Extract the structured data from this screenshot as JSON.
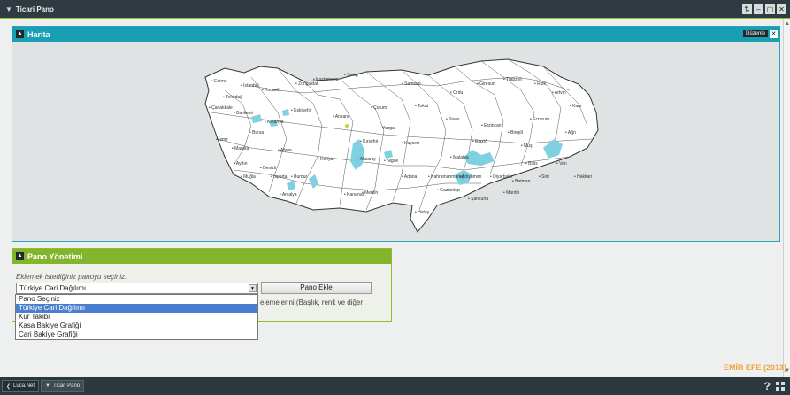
{
  "window": {
    "title": "Ticari Pano",
    "controls": [
      "⇅",
      "–",
      "▢",
      "✕"
    ]
  },
  "map_panel": {
    "title": "Harita",
    "edit_label": "Düzenle",
    "close_label": "✕",
    "lake_color": "#7fd0e0",
    "province_fill": "#ffffff",
    "city_labels": [
      {
        "name": "Edirne"
      },
      {
        "name": "İstanbul"
      },
      {
        "name": "Tekirdağ"
      },
      {
        "name": "Kocaeli"
      },
      {
        "name": "Bursa"
      },
      {
        "name": "Balıkesir"
      },
      {
        "name": "Çanakkale"
      },
      {
        "name": "İzmir"
      },
      {
        "name": "Manisa"
      },
      {
        "name": "Aydın"
      },
      {
        "name": "Muğla"
      },
      {
        "name": "Denizli"
      },
      {
        "name": "Afyon"
      },
      {
        "name": "Kütahya"
      },
      {
        "name": "Eskişehir"
      },
      {
        "name": "Ankara"
      },
      {
        "name": "Konya"
      },
      {
        "name": "Antalya"
      },
      {
        "name": "Isparta"
      },
      {
        "name": "Burdur"
      },
      {
        "name": "Kastamonu"
      },
      {
        "name": "Sinop"
      },
      {
        "name": "Samsun"
      },
      {
        "name": "Çorum"
      },
      {
        "name": "Yozgat"
      },
      {
        "name": "Kırşehir"
      },
      {
        "name": "Kayseri"
      },
      {
        "name": "Sivas"
      },
      {
        "name": "Tokat"
      },
      {
        "name": "Ordu"
      },
      {
        "name": "Giresun"
      },
      {
        "name": "Trabzon"
      },
      {
        "name": "Rize"
      },
      {
        "name": "Artvin"
      },
      {
        "name": "Erzurum"
      },
      {
        "name": "Kars"
      },
      {
        "name": "Ağrı"
      },
      {
        "name": "Van"
      },
      {
        "name": "Muş"
      },
      {
        "name": "Bitlis"
      },
      {
        "name": "Diyarbakır"
      },
      {
        "name": "Mardin"
      },
      {
        "name": "Şanlıurfa"
      },
      {
        "name": "Adıyaman"
      },
      {
        "name": "Malatya"
      },
      {
        "name": "Elazığ"
      },
      {
        "name": "Adana"
      },
      {
        "name": "Mersin"
      },
      {
        "name": "Hatay"
      },
      {
        "name": "Gaziantep"
      },
      {
        "name": "Niğde"
      },
      {
        "name": "Aksaray"
      },
      {
        "name": "Karaman"
      },
      {
        "name": "Erzincan"
      },
      {
        "name": "Bingöl"
      },
      {
        "name": "Siirt"
      },
      {
        "name": "Hakkari"
      },
      {
        "name": "Batman"
      },
      {
        "name": "Kahramanmaraş"
      },
      {
        "name": "Zonguldak"
      }
    ]
  },
  "pano_panel": {
    "title": "Pano Yönetimi",
    "hint": "Eklemek istediğiniz panoyu seçiniz.",
    "selected_value": "Türkiye Cari Dağılımı",
    "add_button": "Pano Ekle",
    "description": "elemelerini (Başlık, renk ve diğer"
  },
  "dropdown": {
    "options": [
      {
        "label": "Pano Seçiniz",
        "selected": false
      },
      {
        "label": "Türkiye Cari Dağılımı",
        "selected": true
      },
      {
        "label": "Kur Takibi",
        "selected": false
      },
      {
        "label": "Kasa Bakiye Grafiği",
        "selected": false
      },
      {
        "label": "Cari Bakiye Grafiği",
        "selected": false
      }
    ]
  },
  "copyright": "EMİR EFE (2013)",
  "taskbar": {
    "start_label": "Luca.Net",
    "task_label": "Ticari Pano",
    "help_label": "?"
  },
  "colors": {
    "accent_teal": "#199fb4",
    "accent_green": "#83b52c",
    "titlebar": "#2f3b40",
    "selected_option": "#4a7fcf",
    "copyright": "#f0a23c"
  }
}
